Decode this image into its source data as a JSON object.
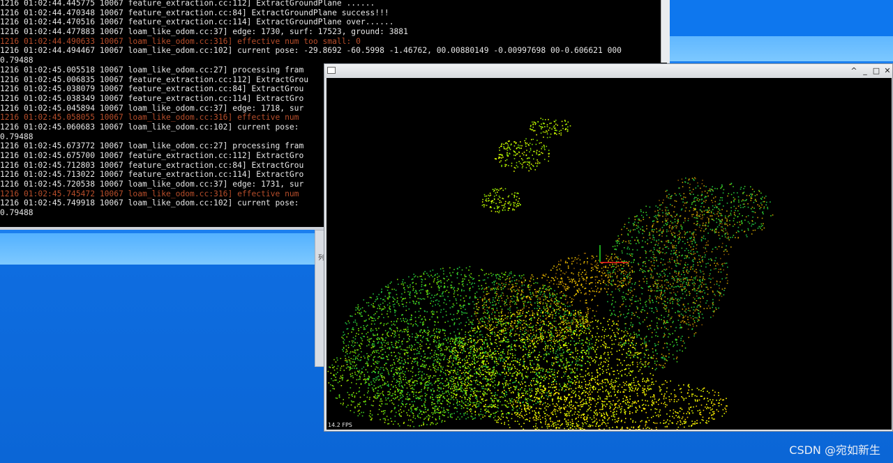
{
  "terminal": {
    "lines": [
      {
        "text": "1216 01:02:44.445775 10067 feature_extraction.cc:112] ExtractGroundPlane ......",
        "warn": false
      },
      {
        "text": "1216 01:02:44.470348 10067 feature_extraction.cc:84] ExtractGroundPlane success!!!",
        "warn": false
      },
      {
        "text": "1216 01:02:44.470516 10067 feature_extraction.cc:114] ExtractGroundPlane over......",
        "warn": false
      },
      {
        "text": "1216 01:02:44.477883 10067 loam_like_odom.cc:37] edge: 1730, surf: 17523, ground: 3881",
        "warn": false
      },
      {
        "text": "1216 01:02:44.490633 10067 loam_like_odom.cc:316] effective num too small: 0",
        "warn": true
      },
      {
        "text": "1216 01:02:44.494467 10067 loam_like_odom.cc:102] current pose: -29.8692 -60.5998 -1.46762, 00.00880149 -0.00997698 00-0.606621 000",
        "warn": false
      },
      {
        "text": "0.79488",
        "warn": false
      },
      {
        "text": "1216 01:02:45.005518 10067 loam_like_odom.cc:27] processing fram",
        "warn": false
      },
      {
        "text": "1216 01:02:45.006835 10067 feature_extraction.cc:112] ExtractGrou",
        "warn": false
      },
      {
        "text": "1216 01:02:45.038079 10067 feature_extraction.cc:84] ExtractGrou",
        "warn": false
      },
      {
        "text": "1216 01:02:45.038349 10067 feature_extraction.cc:114] ExtractGro",
        "warn": false
      },
      {
        "text": "1216 01:02:45.045894 10067 loam_like_odom.cc:37] edge: 1718, sur",
        "warn": false
      },
      {
        "text": "1216 01:02:45.058055 10067 loam_like_odom.cc:316] effective num",
        "warn": true
      },
      {
        "text": "1216 01:02:45.060683 10067 loam_like_odom.cc:102] current pose:",
        "warn": false
      },
      {
        "text": "0.79488",
        "warn": false
      },
      {
        "text": "1216 01:02:45.673772 10067 loam_like_odom.cc:27] processing fram",
        "warn": false
      },
      {
        "text": "1216 01:02:45.675700 10067 feature_extraction.cc:112] ExtractGro",
        "warn": false
      },
      {
        "text": "1216 01:02:45.712803 10067 feature_extraction.cc:84] ExtractGrou",
        "warn": false
      },
      {
        "text": "1216 01:02:45.713022 10067 feature_extraction.cc:114] ExtractGro",
        "warn": false
      },
      {
        "text": "1216 01:02:45.720538 10067 loam_like_odom.cc:37] edge: 1731, sur",
        "warn": false
      },
      {
        "text": "1216 01:02:45.745472 10067 loam_like_odom.cc:316] effective num",
        "warn": true
      },
      {
        "text": "1216 01:02:45.749918 10067 loam_like_odom.cc:102] current pose:",
        "warn": false
      },
      {
        "text": "0.79488",
        "warn": false
      }
    ],
    "warn_color": "#b84e2b"
  },
  "viewer": {
    "controls": {
      "up": "^",
      "minimize": "_",
      "maximize": "□",
      "close": "✕"
    },
    "fps": "14.2 FPS",
    "point_colors": [
      "#ffff00",
      "#e6ff00",
      "#b8f000",
      "#7fe000",
      "#3fd020",
      "#20c040",
      "#c8a000",
      "#8a5a00",
      "#ffd400"
    ]
  },
  "side_panel": {
    "label": "列"
  },
  "watermark": "CSDN @宛如新生"
}
